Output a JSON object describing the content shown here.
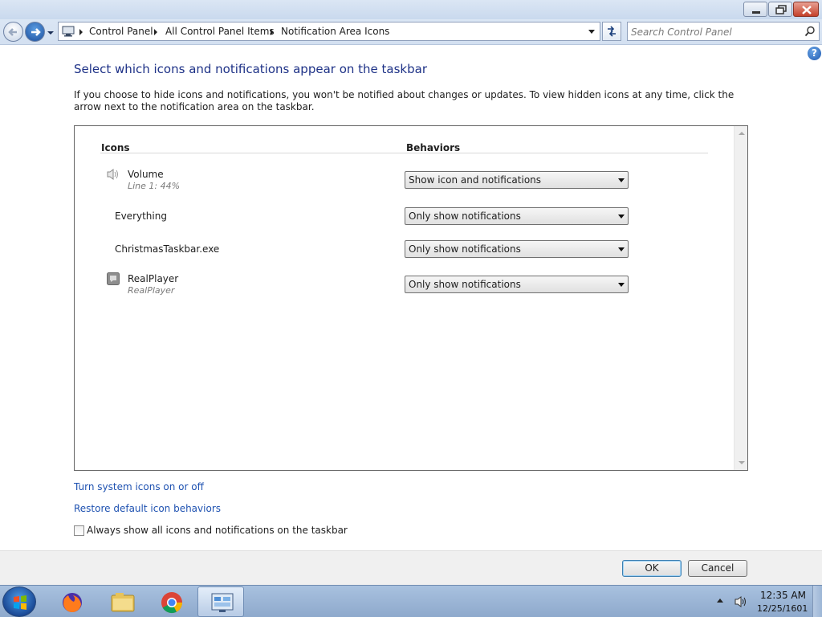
{
  "addressbar": {
    "crumbs": [
      "Control Panel",
      "All Control Panel Items",
      "Notification Area Icons"
    ]
  },
  "search": {
    "placeholder": "Search Control Panel"
  },
  "help": {
    "label": "?"
  },
  "page": {
    "title": "Select which icons and notifications appear on the taskbar",
    "intro": "If you choose to hide icons and notifications, you won't be notified about changes or updates. To view hidden icons at any time, click the arrow next to the notification area on the taskbar."
  },
  "table": {
    "col_icons": "Icons",
    "col_behaviors": "Behaviors",
    "rows": [
      {
        "name": "Volume",
        "sub": "Line 1: 44%",
        "icon": "speaker-icon",
        "behavior": "Show icon and notifications"
      },
      {
        "name": "Everything",
        "sub": "",
        "icon": "",
        "behavior": "Only show notifications"
      },
      {
        "name": "ChristmasTaskbar.exe",
        "sub": "",
        "icon": "",
        "behavior": "Only show notifications"
      },
      {
        "name": "RealPlayer",
        "sub": "RealPlayer",
        "icon": "realplayer-icon",
        "behavior": "Only show notifications"
      }
    ]
  },
  "links": {
    "turn_system_icons": "Turn system icons on or off",
    "restore_defaults": "Restore default icon behaviors"
  },
  "always_show": {
    "label": "Always show all icons and notifications on the taskbar",
    "checked": false
  },
  "buttons": {
    "ok": "OK",
    "cancel": "Cancel"
  },
  "taskbar": {
    "items": [
      "start-orb-icon",
      "firefox-icon",
      "file-explorer-icon",
      "chrome-icon",
      "control-panel-icon"
    ],
    "clock_time": "12:35 AM",
    "clock_date": "12/25/1601"
  },
  "colors": {
    "title_blue": "#1e3287",
    "link_blue": "#1f52b1",
    "taskbar": "#9bb4d6"
  }
}
